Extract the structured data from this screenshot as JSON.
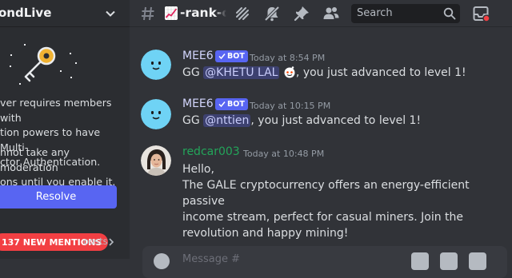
{
  "server": {
    "name": "ondLive",
    "notice_1": "ver requires members with\ntion powers to have Multi-\nctor Authentication.",
    "notice_2": "nnot take any moderation\nons until you enable it.",
    "resolve_label": "Resolve",
    "mentions_label": "137 NEW MENTIONS",
    "boosts_label": "oosts"
  },
  "channel": {
    "name": "-rank-ch",
    "search_placeholder": "Search"
  },
  "messages": [
    {
      "author": "MEE6",
      "author_color": "#d3d6fd",
      "bot_tag": "BOT",
      "timestamp": "Today at 8:54 PM",
      "prefix": "GG ",
      "mention": "@KHETU LAL",
      "suffix": ", you just advanced to level 1!"
    },
    {
      "author": "MEE6",
      "author_color": "#d3d6fd",
      "bot_tag": "BOT",
      "timestamp": "Today at 10:15 PM",
      "prefix": "GG ",
      "mention": "@nttien",
      "suffix": ", you just advanced to level 1!"
    },
    {
      "author": "redcar003",
      "author_color": "#23a55a",
      "timestamp": "Today at 10:48 PM",
      "line1": "Hello,",
      "paragraph": "The GALE cryptocurrency offers an energy-efficient passive\nincome stream, perfect for casual miners. Join the\nrevolution and happy mining!"
    }
  ],
  "composer": {
    "placeholder": "Message #"
  },
  "colors": {
    "accent": "#5865f2",
    "danger": "#f23f43",
    "mee6_avatar": "#6fd3f5"
  },
  "icons": {
    "server_menu": "chevron-down-icon",
    "channel": "hash-icon",
    "threads": "threads-icon",
    "mute": "bell-slash-icon",
    "pins": "pin-icon",
    "members": "members-icon",
    "search": "search-icon",
    "inbox": "inbox-icon"
  }
}
